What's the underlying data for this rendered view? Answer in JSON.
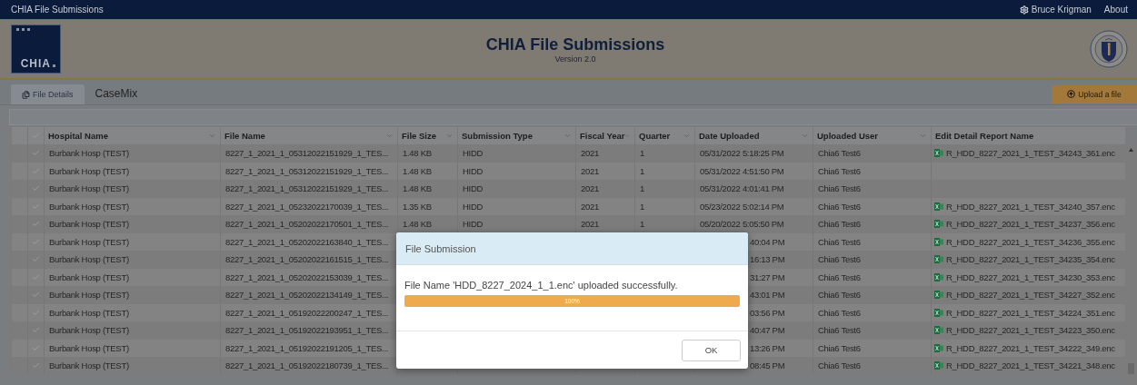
{
  "app_bar": {
    "title": "CHIA File Submissions",
    "user": "Bruce Krigman",
    "about": "About"
  },
  "header": {
    "logo_text": "CHIA",
    "title": "CHIA File Submissions",
    "version": "Version 2.0"
  },
  "tabs": [
    {
      "label": "File Details",
      "selected": true
    },
    {
      "label": "CaseMix",
      "selected": false
    }
  ],
  "upload_button": "Upload a file",
  "table": {
    "columns": [
      {
        "label": "Hospital Name",
        "filter": true
      },
      {
        "label": "File Name",
        "filter": true
      },
      {
        "label": "File Size",
        "filter": true
      },
      {
        "label": "Submission Type",
        "filter": true
      },
      {
        "label": "Fiscal Year",
        "filter": true
      },
      {
        "label": "Quarter",
        "filter": true
      },
      {
        "label": "Date Uploaded",
        "filter": true
      },
      {
        "label": "Uploaded User",
        "filter": true
      },
      {
        "label": "Edit Detail Report Name",
        "filter": false
      }
    ],
    "rows": [
      {
        "checked": false,
        "hospital": "Burbank Hosp (TEST)",
        "file_name": "8227_1_2021_1_05312022151929_1_TES...",
        "file_size": "1.48 KB",
        "submission_type": "HIDD",
        "fiscal_year": "2021",
        "quarter": "1",
        "date_uploaded": "05/31/2022 5:18:25 PM",
        "uploaded_user": "Chia6 Test6",
        "report": "R_HDD_8227_2021_1_TEST_34243_361.enc"
      },
      {
        "checked": false,
        "hospital": "Burbank Hosp (TEST)",
        "file_name": "8227_1_2021_1_05312022151929_1_TES...",
        "file_size": "1.48 KB",
        "submission_type": "HIDD",
        "fiscal_year": "2021",
        "quarter": "1",
        "date_uploaded": "05/31/2022 4:51:50 PM",
        "uploaded_user": "Chia6 Test6"
      },
      {
        "checked": false,
        "hospital": "Burbank Hosp (TEST)",
        "file_name": "8227_1_2021_1_05312022151929_1_TES...",
        "file_size": "1.48 KB",
        "submission_type": "HIDD",
        "fiscal_year": "2021",
        "quarter": "1",
        "date_uploaded": "05/31/2022 4:01:41 PM",
        "uploaded_user": "Chia6 Test6"
      },
      {
        "checked": false,
        "hospital": "Burbank Hosp (TEST)",
        "file_name": "8227_1_2021_1_05232022170039_1_TES...",
        "file_size": "1.35 KB",
        "submission_type": "HIDD",
        "fiscal_year": "2021",
        "quarter": "1",
        "date_uploaded": "05/23/2022 5:02:14 PM",
        "uploaded_user": "Chia6 Test6",
        "report": "R_HDD_8227_2021_1_TEST_34240_357.enc"
      },
      {
        "checked": false,
        "hospital": "Burbank Hosp (TEST)",
        "file_name": "8227_1_2021_1_05202022170501_1_TES...",
        "file_size": "1.48 KB",
        "submission_type": "HIDD",
        "fiscal_year": "2021",
        "quarter": "1",
        "date_uploaded": "05/20/2022 5:05:50 PM",
        "uploaded_user": "Chia6 Test6",
        "report": "R_HDD_8227_2021_1_TEST_34237_356.enc"
      },
      {
        "checked": false,
        "hospital": "Burbank Hosp (TEST)",
        "file_name": "8227_1_2021_1_05202022163840_1_TES...",
        "date_uploaded": "40:04 PM",
        "uploaded_user": "Chia6 Test6",
        "report": "R_HDD_8227_2021_1_TEST_34236_355.enc"
      },
      {
        "checked": false,
        "hospital": "Burbank Hosp (TEST)",
        "file_name": "8227_1_2021_1_05202022161515_1_TES...",
        "date_uploaded": "16:13 PM",
        "uploaded_user": "Chia6 Test6",
        "report": "R_HDD_8227_2021_1_TEST_34235_354.enc"
      },
      {
        "checked": false,
        "hospital": "Burbank Hosp (TEST)",
        "file_name": "8227_1_2021_1_05202022153039_1_TES...",
        "date_uploaded": "31:27 PM",
        "uploaded_user": "Chia6 Test6",
        "report": "R_HDD_8227_2021_1_TEST_34230_353.enc"
      },
      {
        "checked": false,
        "hospital": "Burbank Hosp (TEST)",
        "file_name": "8227_1_2021_1_05202022134149_1_TES...",
        "date_uploaded": "43:01 PM",
        "uploaded_user": "Chia6 Test6",
        "report": "R_HDD_8227_2021_1_TEST_34227_352.enc"
      },
      {
        "checked": false,
        "hospital": "Burbank Hosp (TEST)",
        "file_name": "8227_1_2021_1_05192022200247_1_TES...",
        "date_uploaded": "03:56 PM",
        "uploaded_user": "Chia6 Test6",
        "report": "R_HDD_8227_2021_1_TEST_34224_351.enc"
      },
      {
        "checked": false,
        "hospital": "Burbank Hosp (TEST)",
        "file_name": "8227_1_2021_1_05192022193951_1_TES...",
        "date_uploaded": "40:47 PM",
        "uploaded_user": "Chia6 Test6",
        "report": "R_HDD_8227_2021_1_TEST_34223_350.enc"
      },
      {
        "checked": false,
        "hospital": "Burbank Hosp (TEST)",
        "file_name": "8227_1_2021_1_05192022191205_1_TES...",
        "date_uploaded": "13:26 PM",
        "uploaded_user": "Chia6 Test6",
        "report": "R_HDD_8227_2021_1_TEST_34222_349.enc"
      },
      {
        "checked": false,
        "hospital": "Burbank Hosp (TEST)",
        "file_name": "8227_1_2021_1_05192022180739_1_TES...",
        "date_uploaded": "08:45 PM",
        "uploaded_user": "Chia6 Test6",
        "report": "R_HDD_8227_2021_1_TEST_34221_348.enc"
      }
    ]
  },
  "dialog": {
    "title": "File Submission",
    "message": "File Name 'HDD_8227_2024_1_1.enc' uploaded successfully.",
    "progress": {
      "level": 1,
      "label": "100%"
    },
    "ok_button": "OK"
  }
}
